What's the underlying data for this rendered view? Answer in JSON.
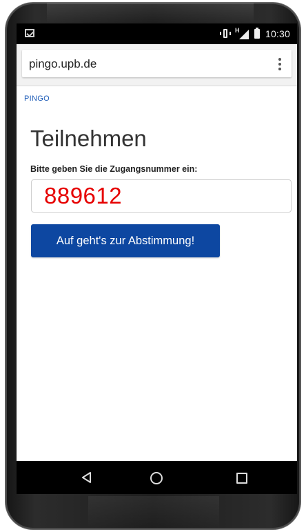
{
  "status_bar": {
    "time": "10:30",
    "left_icon": "gmail-icon",
    "icons": [
      "vibrate-icon",
      "signal-icon",
      "battery-icon"
    ]
  },
  "browser": {
    "url": "pingo.upb.de",
    "menu_icon": "more-vert-icon"
  },
  "page": {
    "brand_link": "PINGO",
    "heading": "Teilnehmen",
    "instruction": "Bitte geben Sie die Zugangsnummer ein:",
    "access_code": "889612",
    "submit_label": "Auf geht's zur Abstimmung!"
  },
  "nav_bar": {
    "icons": [
      "back-icon",
      "home-icon",
      "recents-icon"
    ]
  },
  "colors": {
    "button": "#0d47a1",
    "link": "#1f5db8",
    "code_text": "#e60000"
  }
}
